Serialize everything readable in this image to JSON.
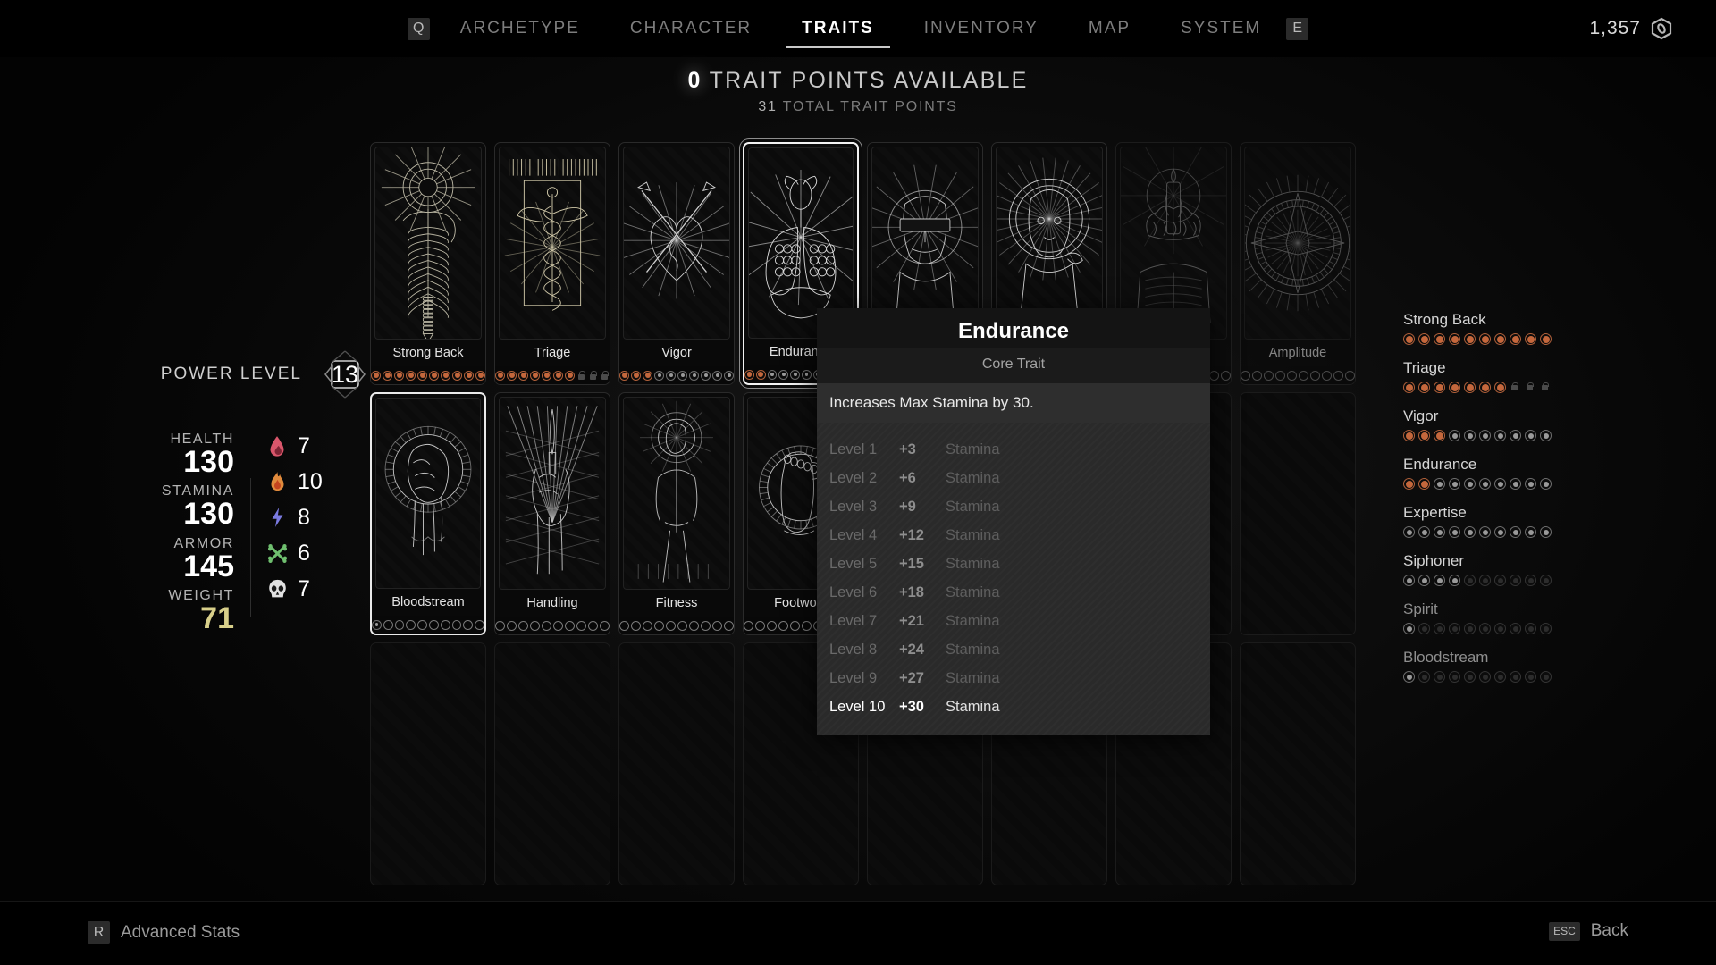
{
  "nav": {
    "left_key": "Q",
    "right_key": "E",
    "items": [
      {
        "label": "ARCHETYPE",
        "active": false
      },
      {
        "label": "CHARACTER",
        "active": false
      },
      {
        "label": "TRAITS",
        "active": true
      },
      {
        "label": "INVENTORY",
        "active": false
      },
      {
        "label": "MAP",
        "active": false
      },
      {
        "label": "SYSTEM",
        "active": false
      }
    ],
    "currency": "1,357",
    "currency_icon": "scrap-icon"
  },
  "header": {
    "available_points": "0",
    "available_label": "TRAIT POINTS AVAILABLE",
    "total_points": "31",
    "total_label": "TOTAL TRAIT POINTS"
  },
  "stats": {
    "power_level_label": "POWER LEVEL",
    "power_level": "13",
    "entries": [
      {
        "label": "HEALTH",
        "value": "130",
        "accent": false
      },
      {
        "label": "STAMINA",
        "value": "130",
        "accent": false
      },
      {
        "label": "ARMOR",
        "value": "145",
        "accent": false
      },
      {
        "label": "WEIGHT",
        "value": "71",
        "accent": true
      }
    ],
    "resistances": [
      {
        "icon": "blood-drop-icon",
        "value": "7",
        "color": "#d9566b"
      },
      {
        "icon": "fire-icon",
        "value": "10",
        "color": "#e08a3c"
      },
      {
        "icon": "lightning-icon",
        "value": "8",
        "color": "#7a7ae0"
      },
      {
        "icon": "bones-icon",
        "value": "6",
        "color": "#6fbf6f"
      },
      {
        "icon": "skull-icon",
        "value": "7",
        "color": "#e2e2e2"
      }
    ]
  },
  "cards": {
    "row1": [
      {
        "name": "Strong Back",
        "art": "spine",
        "filled": 10,
        "open": 0,
        "locks": 0,
        "total": 10,
        "state": "normal"
      },
      {
        "name": "Triage",
        "art": "caduceus",
        "filled": 7,
        "open": 0,
        "locks": 3,
        "total": 10,
        "state": "normal"
      },
      {
        "name": "Vigor",
        "art": "heart",
        "filled": 3,
        "open": 7,
        "locks": 0,
        "total": 10,
        "state": "normal"
      },
      {
        "name": "Endurance",
        "art": "lungs",
        "filled": 2,
        "open": 8,
        "locks": 0,
        "total": 10,
        "state": "selected"
      },
      {
        "name": "Expertise",
        "art": "blindfold",
        "filled": 0,
        "open": 10,
        "locks": 0,
        "total": 10,
        "state": "normal"
      },
      {
        "name": "Siphoner",
        "art": "halo-head",
        "filled": 0,
        "open": 4,
        "locks": 0,
        "total": 10,
        "state": "normal"
      },
      {
        "name": "Spirit",
        "art": "candle-brain",
        "filled": 0,
        "open": 1,
        "locks": 0,
        "total": 10,
        "state": "dim"
      },
      {
        "name": "Amplitude",
        "art": "star-compass",
        "filled": 0,
        "open": 0,
        "locks": 0,
        "total": 10,
        "state": "dim"
      }
    ],
    "row2": [
      {
        "name": "Bloodstream",
        "art": "fist",
        "filled": 0,
        "open": 1,
        "locks": 0,
        "total": 10,
        "state": "highlight"
      },
      {
        "name": "Handling",
        "art": "hand-blade",
        "filled": 0,
        "open": 0,
        "locks": 0,
        "total": 10,
        "state": "normal"
      },
      {
        "name": "Fitness",
        "art": "figure",
        "filled": 0,
        "open": 0,
        "locks": 0,
        "total": 10,
        "state": "normal"
      },
      {
        "name": "Footwork",
        "art": "foot",
        "filled": 0,
        "open": 0,
        "locks": 0,
        "total": 10,
        "state": "normal"
      },
      {
        "name": "",
        "art": "empty",
        "filled": 0,
        "open": 0,
        "locks": 0,
        "total": 0,
        "state": "empty"
      },
      {
        "name": "",
        "art": "empty",
        "filled": 0,
        "open": 0,
        "locks": 0,
        "total": 0,
        "state": "empty"
      },
      {
        "name": "",
        "art": "empty",
        "filled": 0,
        "open": 0,
        "locks": 0,
        "total": 0,
        "state": "empty"
      },
      {
        "name": "",
        "art": "empty",
        "filled": 0,
        "open": 0,
        "locks": 0,
        "total": 0,
        "state": "empty"
      }
    ],
    "row3": [
      {
        "name": "",
        "art": "empty",
        "filled": 0,
        "open": 0,
        "locks": 0,
        "total": 0,
        "state": "empty"
      },
      {
        "name": "",
        "art": "empty",
        "filled": 0,
        "open": 0,
        "locks": 0,
        "total": 0,
        "state": "empty"
      },
      {
        "name": "",
        "art": "empty",
        "filled": 0,
        "open": 0,
        "locks": 0,
        "total": 0,
        "state": "empty"
      },
      {
        "name": "",
        "art": "empty",
        "filled": 0,
        "open": 0,
        "locks": 0,
        "total": 0,
        "state": "empty"
      },
      {
        "name": "",
        "art": "empty",
        "filled": 0,
        "open": 0,
        "locks": 0,
        "total": 0,
        "state": "empty"
      },
      {
        "name": "",
        "art": "empty",
        "filled": 0,
        "open": 0,
        "locks": 0,
        "total": 0,
        "state": "empty"
      },
      {
        "name": "",
        "art": "empty",
        "filled": 0,
        "open": 0,
        "locks": 0,
        "total": 0,
        "state": "empty"
      },
      {
        "name": "",
        "art": "empty",
        "filled": 0,
        "open": 0,
        "locks": 0,
        "total": 0,
        "state": "empty"
      }
    ]
  },
  "trait_list": [
    {
      "name": "Strong Back",
      "filled": 10,
      "open": 0,
      "locks": 0,
      "dim": 0,
      "total": 10
    },
    {
      "name": "Triage",
      "filled": 7,
      "open": 0,
      "locks": 3,
      "dim": 0,
      "total": 10
    },
    {
      "name": "Vigor",
      "filled": 3,
      "open": 7,
      "locks": 0,
      "dim": 0,
      "total": 10
    },
    {
      "name": "Endurance",
      "filled": 2,
      "open": 8,
      "locks": 0,
      "dim": 0,
      "total": 10
    },
    {
      "name": "Expertise",
      "filled": 0,
      "open": 10,
      "locks": 0,
      "dim": 0,
      "total": 10
    },
    {
      "name": "Siphoner",
      "filled": 0,
      "open": 4,
      "locks": 0,
      "dim": 6,
      "total": 10
    },
    {
      "name": "Spirit",
      "filled": 0,
      "open": 1,
      "locks": 0,
      "dim": 9,
      "total": 10
    },
    {
      "name": "Bloodstream",
      "filled": 0,
      "open": 1,
      "locks": 0,
      "dim": 9,
      "total": 10
    }
  ],
  "tooltip": {
    "title": "Endurance",
    "subtitle": "Core Trait",
    "description": "Increases Max Stamina by 30.",
    "current_level": 10,
    "levels": [
      {
        "level": "Level 1",
        "amount": "+3",
        "stat": "Stamina"
      },
      {
        "level": "Level 2",
        "amount": "+6",
        "stat": "Stamina"
      },
      {
        "level": "Level 3",
        "amount": "+9",
        "stat": "Stamina"
      },
      {
        "level": "Level 4",
        "amount": "+12",
        "stat": "Stamina"
      },
      {
        "level": "Level 5",
        "amount": "+15",
        "stat": "Stamina"
      },
      {
        "level": "Level 6",
        "amount": "+18",
        "stat": "Stamina"
      },
      {
        "level": "Level 7",
        "amount": "+21",
        "stat": "Stamina"
      },
      {
        "level": "Level 8",
        "amount": "+24",
        "stat": "Stamina"
      },
      {
        "level": "Level 9",
        "amount": "+27",
        "stat": "Stamina"
      },
      {
        "level": "Level 10",
        "amount": "+30",
        "stat": "Stamina"
      }
    ]
  },
  "footer": {
    "left_key": "R",
    "left_label": "Advanced Stats",
    "right_key": "ESC",
    "right_label": "Back"
  },
  "colors": {
    "accent_orange": "#c4673c",
    "weight_yellow": "#d8cf8a",
    "text_primary": "#ffffff",
    "text_muted": "#7d7d7d"
  }
}
